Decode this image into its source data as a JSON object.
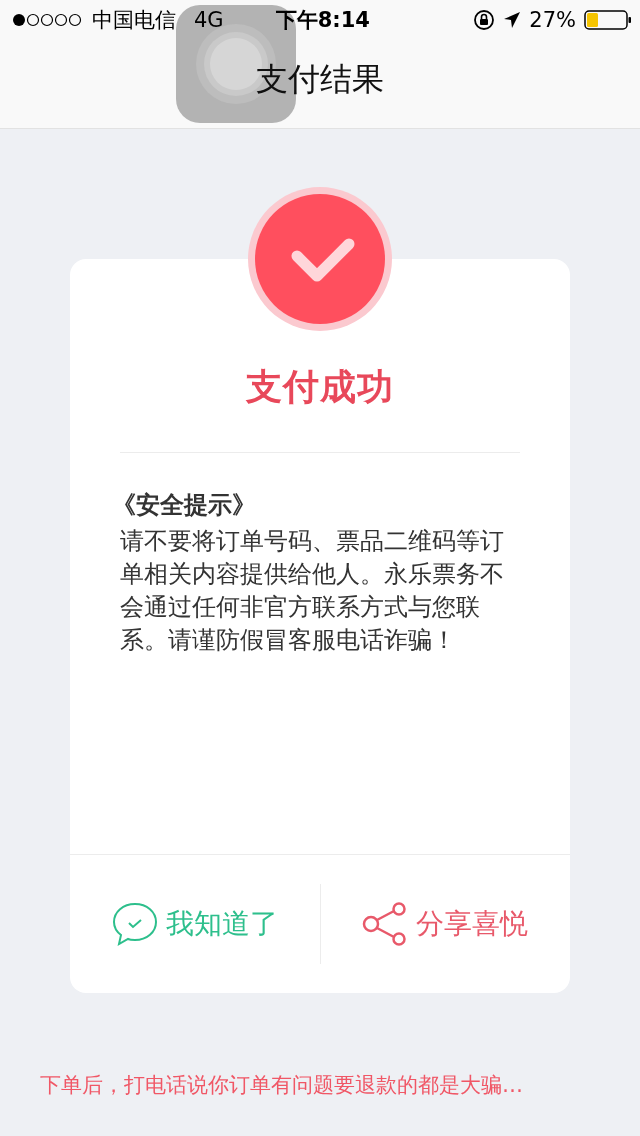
{
  "status_bar": {
    "carrier": "中国电信",
    "network": "4G",
    "time": "下午8:14",
    "battery": "27%"
  },
  "nav": {
    "title": "支付结果"
  },
  "result": {
    "title": "支付成功",
    "notice_heading": "《安全提示》",
    "notice_body": "请不要将订单号码、票品二维码等订单相关内容提供给他人。永乐票务不会通过任何非官方联系方式与您联系。请谨防假冒客服电话诈骗！"
  },
  "actions": [
    {
      "kind": "ok",
      "label": "我知道了"
    },
    {
      "kind": "share",
      "label": "分享喜悦"
    }
  ],
  "footer_note": "下单后，打电话说你订单有问题要退款的都是大骗…"
}
